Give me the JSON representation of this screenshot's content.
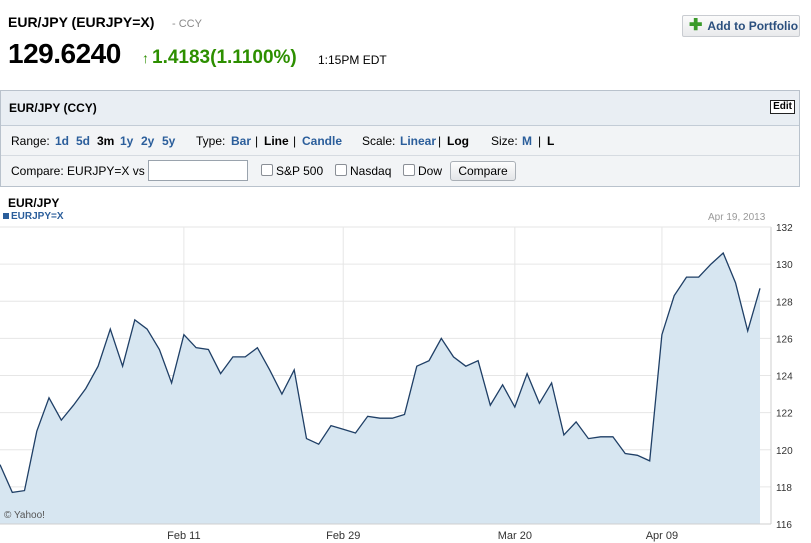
{
  "header": {
    "title": "EUR/JPY (EURJPY=X)",
    "type": "- CCY",
    "price": "129.6240",
    "change_arrow": "↑",
    "change": "1.4183(1.1100%)",
    "time": "1:15PM EDT",
    "add_label": "Add to Portfolio",
    "add_icon": "plus-icon"
  },
  "panel": {
    "title": "EUR/JPY (CCY)",
    "edit_label": "Edit",
    "range_label": "Range:",
    "ranges": [
      "1d",
      "5d",
      "3m",
      "1y",
      "2y",
      "5y"
    ],
    "range_selected": "3m",
    "type_label": "Type:",
    "types": [
      "Bar",
      "Line",
      "Candle"
    ],
    "type_selected": "Line",
    "scale_label": "Scale:",
    "scales": [
      "Linear",
      "Log"
    ],
    "scale_selected": "Log",
    "size_label": "Size:",
    "sizes": [
      "M",
      "L"
    ],
    "size_selected": "L",
    "compare_label": "Compare: EURJPY=X vs",
    "compare_value": "",
    "compare_options": [
      "S&P 500",
      "Nasdaq",
      "Dow"
    ],
    "compare_button": "Compare"
  },
  "chart_area": {
    "title": "EUR/JPY",
    "legend": "EURJPY=X",
    "date": "Apr 19, 2013",
    "copyright": "© Yahoo!",
    "line_color": "#1f3f66",
    "fill_color": "#d7e6f1"
  },
  "chart_data": {
    "type": "area",
    "series": [
      {
        "name": "EURJPY=X",
        "points": [
          [
            "Jan 22",
            119.2
          ],
          [
            "Jan 23",
            117.7
          ],
          [
            "Jan 24",
            117.8
          ],
          [
            "Jan 25",
            121.0
          ],
          [
            "Jan 28",
            122.8
          ],
          [
            "Jan 29",
            121.6
          ],
          [
            "Jan 30",
            122.4
          ],
          [
            "Jan 31",
            123.3
          ],
          [
            "Feb 1",
            124.5
          ],
          [
            "Feb 4",
            126.5
          ],
          [
            "Feb 5",
            124.5
          ],
          [
            "Feb 6",
            127.0
          ],
          [
            "Feb 7",
            126.5
          ],
          [
            "Feb 8",
            125.4
          ],
          [
            "Feb 11",
            123.6
          ],
          [
            "Feb 12",
            126.2
          ],
          [
            "Feb 13",
            125.5
          ],
          [
            "Feb 14",
            125.4
          ],
          [
            "Feb 15",
            124.1
          ],
          [
            "Feb 18",
            125.0
          ],
          [
            "Feb 19",
            125.0
          ],
          [
            "Feb 20",
            125.5
          ],
          [
            "Feb 21",
            124.3
          ],
          [
            "Feb 22",
            123.0
          ],
          [
            "Feb 25",
            124.3
          ],
          [
            "Feb 26",
            120.6
          ],
          [
            "Feb 27",
            120.3
          ],
          [
            "Feb 28",
            121.3
          ],
          [
            "Mar 1",
            121.1
          ],
          [
            "Mar 4",
            120.9
          ],
          [
            "Mar 5",
            121.8
          ],
          [
            "Mar 6",
            121.7
          ],
          [
            "Mar 7",
            121.7
          ],
          [
            "Mar 8",
            121.9
          ],
          [
            "Mar 11",
            124.5
          ],
          [
            "Mar 12",
            124.8
          ],
          [
            "Mar 13",
            126.0
          ],
          [
            "Mar 14",
            125.0
          ],
          [
            "Mar 15",
            124.5
          ],
          [
            "Mar 18",
            124.8
          ],
          [
            "Mar 19",
            122.4
          ],
          [
            "Mar 20",
            123.5
          ],
          [
            "Mar 21",
            122.3
          ],
          [
            "Mar 22",
            124.1
          ],
          [
            "Mar 25",
            122.5
          ],
          [
            "Mar 26",
            123.6
          ],
          [
            "Mar 27",
            120.8
          ],
          [
            "Mar 28",
            121.5
          ],
          [
            "Apr 1",
            120.6
          ],
          [
            "Apr 2",
            120.7
          ],
          [
            "Apr 3",
            120.7
          ],
          [
            "Apr 4",
            119.8
          ],
          [
            "Apr 5",
            119.7
          ],
          [
            "Apr 8",
            119.4
          ],
          [
            "Apr 9",
            126.2
          ],
          [
            "Apr 10",
            128.3
          ],
          [
            "Apr 11",
            129.3
          ],
          [
            "Apr 12",
            129.3
          ],
          [
            "Apr 15",
            130.0
          ],
          [
            "Apr 16",
            130.6
          ],
          [
            "Apr 17",
            129.0
          ],
          [
            "Apr 18",
            126.4
          ],
          [
            "Apr 19",
            128.7
          ]
        ]
      }
    ],
    "final_value": 128.2,
    "xticks": [
      "Feb 11",
      "Feb 29",
      "Mar 20",
      "Apr 09"
    ],
    "yticks": [
      116,
      118,
      120,
      122,
      124,
      126,
      128,
      130,
      132
    ],
    "ylim": [
      116,
      132
    ],
    "grid": true,
    "scale": "linear"
  }
}
